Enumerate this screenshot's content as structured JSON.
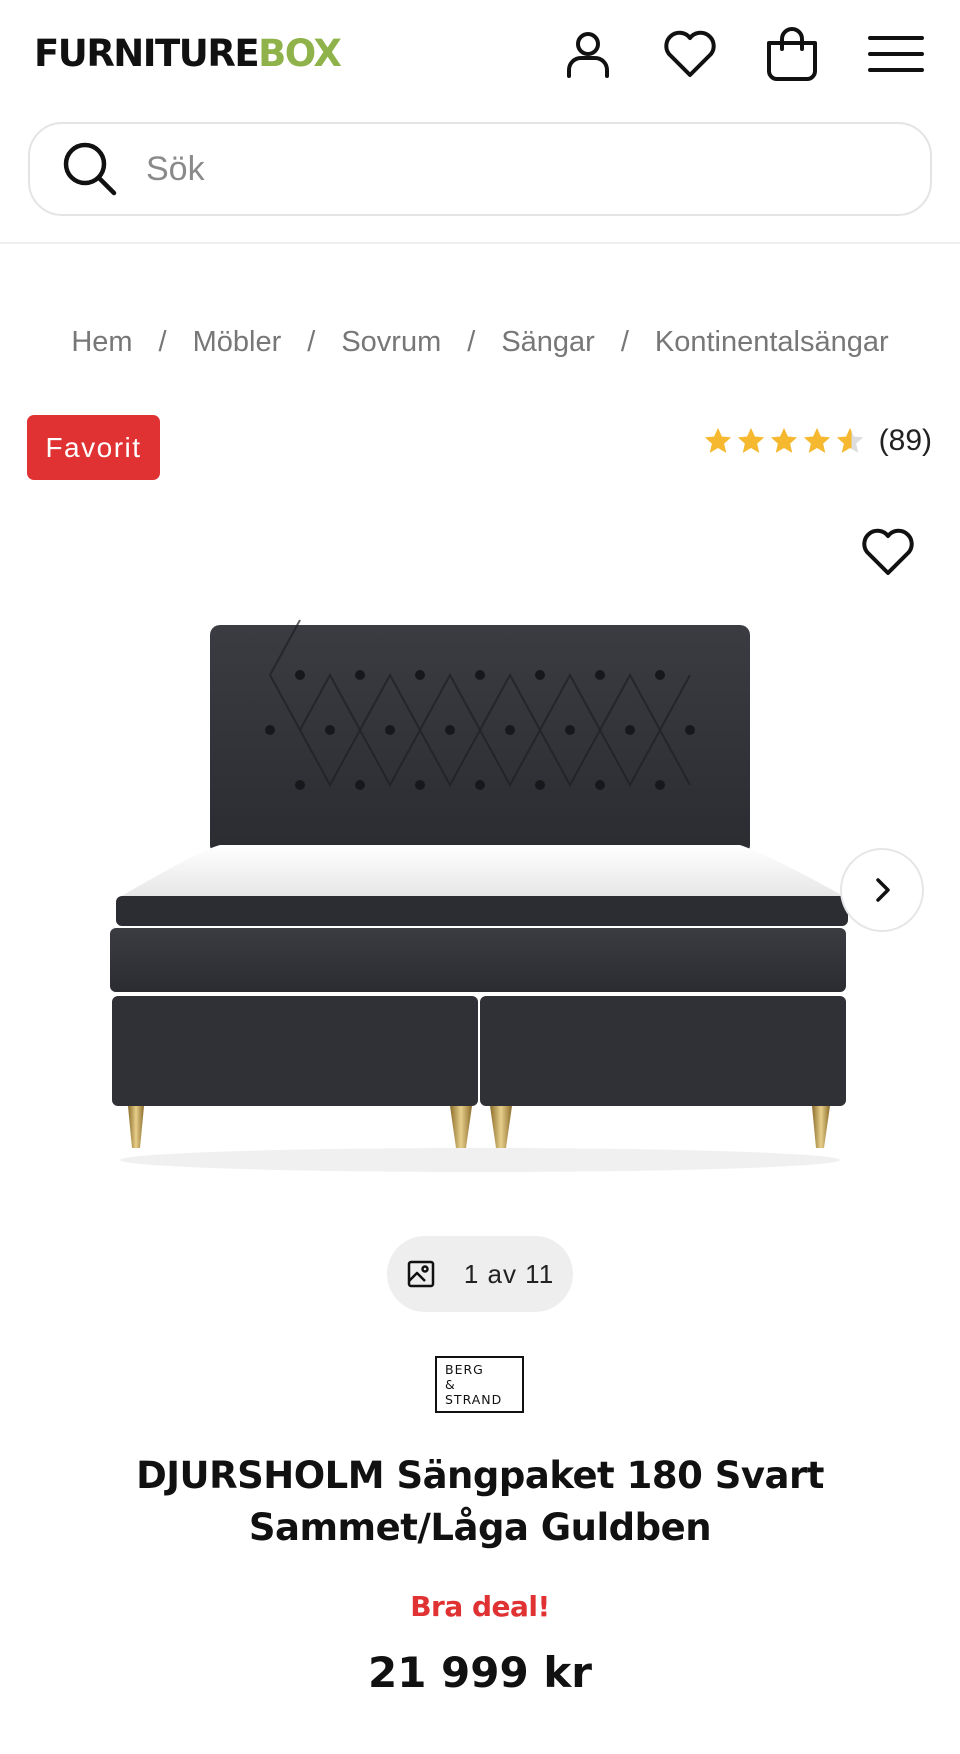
{
  "header": {
    "logo_part1": "FURNITURE",
    "logo_part2": "BOX",
    "logo_accent_color": "#8fb34a",
    "icons": [
      "account-icon",
      "heart-icon",
      "shopping-bag-icon",
      "menu-icon"
    ]
  },
  "search": {
    "placeholder": "Sök"
  },
  "breadcrumb": {
    "items": [
      "Hem",
      "Möbler",
      "Sovrum",
      "Sängar",
      "Kontinentalsängar"
    ],
    "separator": "/"
  },
  "badge": {
    "label": "Favorit",
    "color": "#e03232"
  },
  "rating": {
    "stars": 4.5,
    "max": 5,
    "count_label": "(89)",
    "star_color": "#f5b82e"
  },
  "gallery": {
    "counter_label": "1 av 11",
    "image_alt": "Svart sammet kontinentalsäng med guldben"
  },
  "brand": {
    "line1": "BERG",
    "line2": "&",
    "line3": "STRAND"
  },
  "product": {
    "title": "DJURSHOLM Sängpaket 180 Svart Sammet/Låga Guldben",
    "deal_label": "Bra deal!",
    "price": "21 999 kr"
  }
}
